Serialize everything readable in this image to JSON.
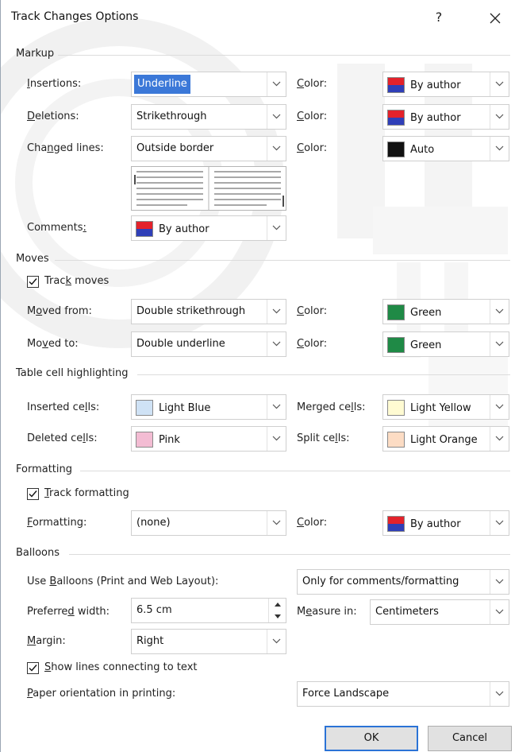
{
  "title": "Track Changes Options",
  "help_label": "?",
  "close_label": "✕",
  "markup": {
    "heading": "Markup",
    "insertions": {
      "label_pre": "",
      "label_u": "I",
      "label_post": "nsertions:",
      "value": "Underline",
      "color_value": "By author"
    },
    "deletions": {
      "label_pre": "",
      "label_u": "D",
      "label_post": "eletions:",
      "value": "Strikethrough",
      "color_value": "By author"
    },
    "changed_lines": {
      "label_pre": "Cha",
      "label_u": "n",
      "label_post": "ged lines:",
      "value": "Outside border",
      "color_value": "Auto"
    },
    "comments": {
      "label_pre": "Comments",
      "label_u": ":",
      "label_post": "",
      "value": "By author"
    },
    "color_pre": "",
    "color_u": "C",
    "color_post": "olor:"
  },
  "moves": {
    "heading": "Moves",
    "track_moves": {
      "pre": "Trac",
      "u": "k",
      "post": " moves",
      "checked": true
    },
    "moved_from": {
      "label_pre": "M",
      "label_u": "o",
      "label_post": "ved from:",
      "value": "Double strikethrough",
      "color_value": "Green"
    },
    "moved_to": {
      "label_pre": "Mo",
      "label_u": "v",
      "label_post": "ed to:",
      "value": "Double underline",
      "color_value": "Green"
    }
  },
  "table_cells": {
    "heading": "Table cell highlighting",
    "inserted": {
      "label_pre": "Inserted ce",
      "label_u": "l",
      "label_post": "ls:",
      "value": "Light Blue",
      "swatch": "#cfe2f5"
    },
    "deleted": {
      "label_pre": "Deleted ce",
      "label_u": "l",
      "label_post": "ls:",
      "value": "Pink",
      "swatch": "#f3bcd3"
    },
    "merged": {
      "label_pre": "Merged ce",
      "label_u": "l",
      "label_post": "ls:",
      "value": "Light Yellow",
      "swatch": "#fffbd2"
    },
    "split": {
      "label_pre": "Split ce",
      "label_u": "l",
      "label_post": "ls:",
      "value": "Light Orange",
      "swatch": "#fcdcc4"
    }
  },
  "formatting": {
    "heading": "Formatting",
    "track_formatting": {
      "pre": "",
      "u": "T",
      "post": "rack formatting",
      "checked": true
    },
    "formatting": {
      "label_pre": "",
      "label_u": "F",
      "label_post": "ormatting:",
      "value": "(none)",
      "color_value": "By author"
    }
  },
  "balloons": {
    "heading": "Balloons",
    "use_balloons": {
      "label_pre": "Use ",
      "label_u": "B",
      "label_post": "alloons (Print and Web Layout):",
      "value": "Only for comments/formatting"
    },
    "preferred_width": {
      "label_pre": "Preferre",
      "label_u": "d",
      "label_post": " width:",
      "value": "6.5 cm"
    },
    "measure_in": {
      "label_pre": "M",
      "label_u": "e",
      "label_post": "asure in:",
      "value": "Centimeters"
    },
    "margin": {
      "label_pre": "",
      "label_u": "M",
      "label_post": "argin:",
      "value": "Right"
    },
    "show_lines": {
      "pre": "",
      "u": "S",
      "post": "how lines connecting to text",
      "checked": true
    },
    "paper_orientation": {
      "label_pre": "",
      "label_u": "P",
      "label_post": "aper orientation in printing:",
      "value": "Force Landscape"
    }
  },
  "buttons": {
    "ok": "OK",
    "cancel": "Cancel"
  },
  "colors": {
    "green": "#1f8a46",
    "auto": "#111111",
    "author_top": "#e3222b",
    "author_bottom": "#2f3fb8",
    "accent": "#2b73d6"
  },
  "watermark": "SU THE UN"
}
